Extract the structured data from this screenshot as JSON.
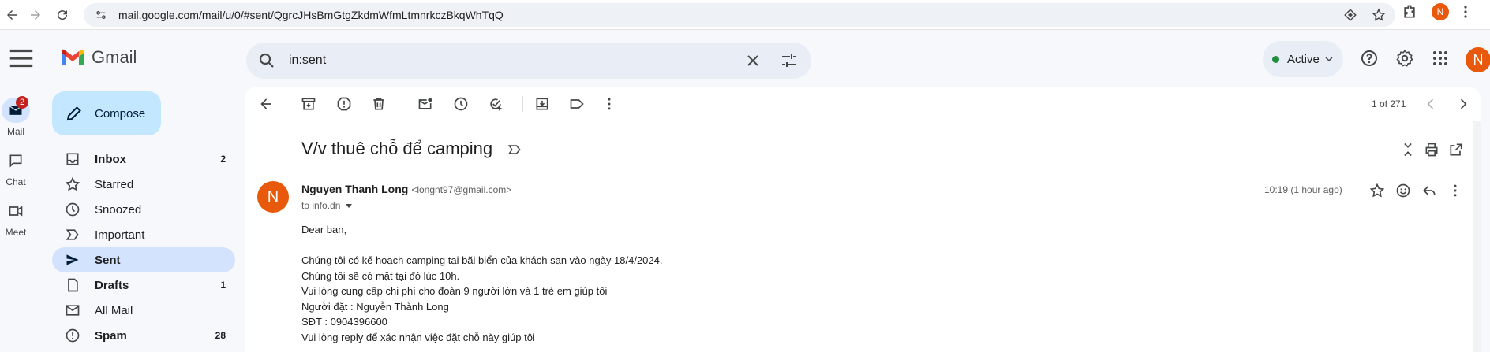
{
  "browser": {
    "url": "mail.google.com/mail/u/0/#sent/QgrcJHsBmGtgZkdmWfmLtmnrkczBkqWhTqQ",
    "profile_initial": "N"
  },
  "header": {
    "app_name": "Gmail",
    "search_value": "in:sent",
    "status": "Active",
    "avatar_initial": "N"
  },
  "rail": {
    "mail_label": "Mail",
    "mail_badge": "2",
    "chat_label": "Chat",
    "meet_label": "Meet"
  },
  "sidebar": {
    "compose_label": "Compose",
    "items": [
      {
        "label": "Inbox",
        "count": "2"
      },
      {
        "label": "Starred",
        "count": ""
      },
      {
        "label": "Snoozed",
        "count": ""
      },
      {
        "label": "Important",
        "count": ""
      },
      {
        "label": "Sent",
        "count": ""
      },
      {
        "label": "Drafts",
        "count": "1"
      },
      {
        "label": "All Mail",
        "count": ""
      },
      {
        "label": "Spam",
        "count": "28"
      }
    ]
  },
  "toolbar": {
    "pager_text": "1 of 271"
  },
  "message": {
    "subject": "V/v thuê chỗ để camping",
    "sender_name": "Nguyen Thanh Long",
    "sender_email": "<longnt97@gmail.com>",
    "to_line": "to info.dn",
    "timestamp": "10:19 (1 hour ago)",
    "avatar_initial": "N",
    "body": [
      "Dear bạn,",
      "",
      "Chúng tôi có kế hoạch camping tại bãi biển của khách sạn vào ngày 18/4/2024.",
      "Chúng tôi sẽ có mặt tại đó lúc 10h.",
      "Vui lòng cung cấp chi phí cho đoàn 9 người lớn và 1 trẻ em giúp tôi",
      "Người đặt : Nguyễn Thành Long",
      "SĐT : 0904396600",
      "Vui lòng reply để xác nhận việc đặt chỗ này giúp tôi"
    ]
  },
  "colors": {
    "accent": "#0b57d0",
    "active_nav": "#d3e3fd",
    "compose_bg": "#c2e7ff",
    "avatar": "#e8590c",
    "badge": "#c5221f",
    "status_dot": "#1e8e3e"
  }
}
